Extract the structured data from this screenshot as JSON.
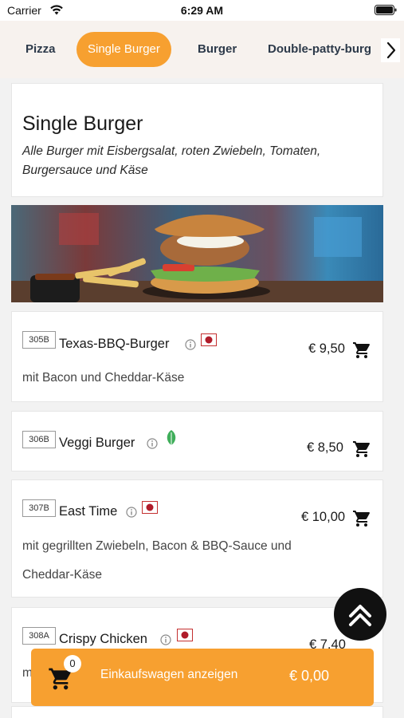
{
  "status_bar": {
    "carrier": "Carrier",
    "time": "6:29 AM"
  },
  "tabs": {
    "items": [
      {
        "label": "Pizza",
        "active": false
      },
      {
        "label": "Single Burger",
        "active": true
      },
      {
        "label": "Burger",
        "active": false
      },
      {
        "label": "Double-patty-burg",
        "active": false
      }
    ],
    "next_icon": "chevron-right"
  },
  "section": {
    "title": "Single Burger",
    "description": "Alle Burger mit Eisbergsalat, roten Zwiebeln, Tomaten, Burgersauce und Käse",
    "banner_image": "burger-and-fries-photo"
  },
  "items": [
    {
      "code": "305B",
      "name": "Texas-BBQ-Burger",
      "price": "€ 9,50",
      "badge": "flag-icon",
      "description_lines": [
        "mit Bacon und Cheddar-Käse"
      ]
    },
    {
      "code": "306B",
      "name": "Veggi Burger",
      "price": "€ 8,50",
      "badge": "leaf-icon",
      "description_lines": []
    },
    {
      "code": "307B",
      "name": "East Time",
      "price": "€ 10,00",
      "badge": "flag-icon",
      "description_lines": [
        "mit gegrillten Zwiebeln, Bacon & BBQ-Sauce und",
        "Cheddar-Käse"
      ]
    },
    {
      "code": "308A",
      "name": "Crispy Chicken",
      "price": "€ 7,40",
      "badge": "flag-icon",
      "description_lines": [
        "m"
      ]
    }
  ],
  "cart": {
    "count": "0",
    "label": "Einkaufswagen anzeigen",
    "total": "€ 0,00"
  },
  "colors": {
    "accent": "#f7a030",
    "tab_text": "#2d3a4a",
    "scroll_button": "#111111"
  }
}
